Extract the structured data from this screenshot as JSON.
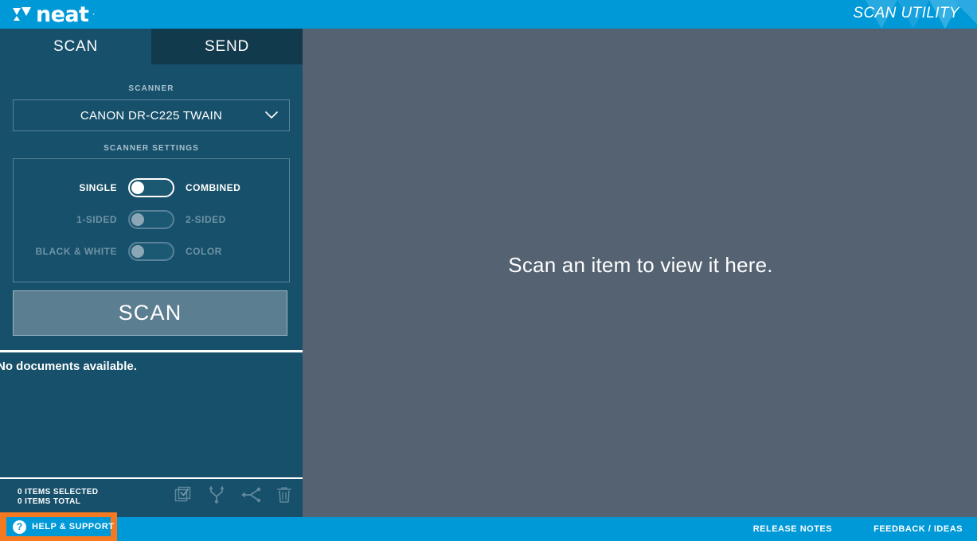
{
  "header": {
    "logo_text": "neat",
    "logo_mark": "neat-triangle-logo-icon",
    "title": "SCAN UTILITY",
    "brand_color": "#0099d8"
  },
  "sidebar": {
    "background_color": "#17506b",
    "tabs": [
      {
        "label": "SCAN",
        "active": true
      },
      {
        "label": "SEND",
        "active": false
      }
    ],
    "scanner": {
      "label": "SCANNER",
      "selected": "CANON DR-C225 TWAIN",
      "caret_icon": "chevron-down-icon"
    },
    "scanner_settings": {
      "label": "SCANNER SETTINGS",
      "toggles": [
        {
          "left_label": "SINGLE",
          "right_label": "COMBINED",
          "enabled": true,
          "position": "left"
        },
        {
          "left_label": "1-SIDED",
          "right_label": "2-SIDED",
          "enabled": false,
          "position": "left"
        },
        {
          "left_label": "BLACK & WHITE",
          "right_label": "COLOR",
          "enabled": false,
          "position": "left"
        }
      ]
    },
    "scan_button": "SCAN",
    "document_list": {
      "empty_message": "No documents available."
    },
    "status": {
      "selected_count": "0 ITEMS SELECTED",
      "total_count": "0 ITEMS TOTAL",
      "icons": [
        {
          "name": "select-all-checkbox-icon"
        },
        {
          "name": "split-documents-icon"
        },
        {
          "name": "merge-documents-icon"
        },
        {
          "name": "delete-trash-icon"
        }
      ]
    }
  },
  "main": {
    "background_color": "#546272",
    "empty_message": "Scan an item to view it here."
  },
  "footer": {
    "background_color": "#0099d8",
    "highlight_color": "#f47920",
    "help_label": "HELP & SUPPORT",
    "help_icon": "question-mark-icon",
    "links": [
      {
        "label": "RELEASE NOTES"
      },
      {
        "label": "FEEDBACK / IDEAS"
      }
    ]
  }
}
